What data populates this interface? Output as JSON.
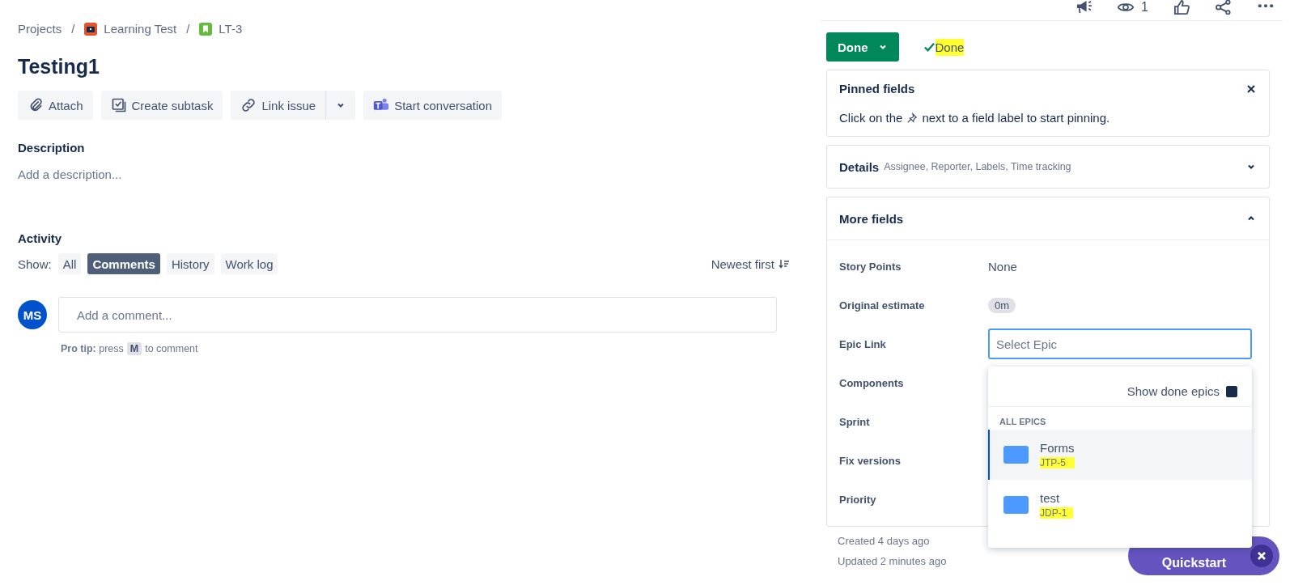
{
  "breadcrumb_separator": "/",
  "breadcrumbs": [
    {
      "label": "Projects",
      "kind": "text"
    },
    {
      "label": "Learning Test",
      "kind": "project"
    },
    {
      "label": "LT-3",
      "kind": "issue"
    }
  ],
  "title": "Testing1",
  "actions": [
    {
      "label": "Attach",
      "kind": "attach"
    },
    {
      "label": "Create subtask",
      "kind": "subtask"
    },
    {
      "label": "Link issue",
      "kind": "link"
    },
    {
      "label": "Start conversation",
      "kind": "teams"
    }
  ],
  "description": {
    "heading": "Description",
    "placeholder": "Add a description..."
  },
  "activity": {
    "heading": "Activity",
    "show_label": "Show:",
    "filters": [
      {
        "label": "All",
        "selected": false
      },
      {
        "label": "Comments",
        "selected": true
      },
      {
        "label": "History",
        "selected": false
      },
      {
        "label": "Work log",
        "selected": false
      }
    ],
    "sort": "Newest first",
    "avatar": "MS",
    "comment_placeholder": "Add a comment...",
    "tip_lead": "**Pro tip:** press",
    "tip_key": "M",
    "tip_end": "to comment"
  },
  "header": {
    "watchers": "1"
  },
  "status": {
    "button": "Done",
    "resolution": "Done"
  },
  "pinned": {
    "title": "Pinned fields",
    "text_before": "Click on the",
    "text_after": "next to a field label to start pinning."
  },
  "details": {
    "title": "Details",
    "summary": "Assignee, Reporter, Labels, Time tracking",
    "expanded": false
  },
  "more_fields": {
    "title": "More fields",
    "expanded": true,
    "fields": [
      {
        "label": "Story Points",
        "kind": "text",
        "value": "None"
      },
      {
        "label": "Original estimate",
        "kind": "badge",
        "value": "0m"
      },
      {
        "label": "Epic Link",
        "kind": "epic"
      },
      {
        "label": "Components",
        "kind": "empty"
      },
      {
        "label": "Sprint",
        "kind": "empty"
      },
      {
        "label": "Fix versions",
        "kind": "empty"
      },
      {
        "label": "Priority",
        "kind": "empty"
      }
    ]
  },
  "epic_dropdown": {
    "placeholder": "Select Epic",
    "show_done": {
      "label": "Show done epics",
      "checked": true
    },
    "group": "ALL EPICS",
    "epics": [
      {
        "name": "Forms",
        "key": "JTP-5",
        "selected": true,
        "color": "#4c9aff"
      },
      {
        "name": "test",
        "key": "JDP-1",
        "selected": false,
        "color": "#4c9aff"
      }
    ]
  },
  "footer": {
    "created": "Created 4 days ago",
    "updated": "Updated 2 minutes ago"
  },
  "quickstart": {
    "label": "Quickstart"
  }
}
